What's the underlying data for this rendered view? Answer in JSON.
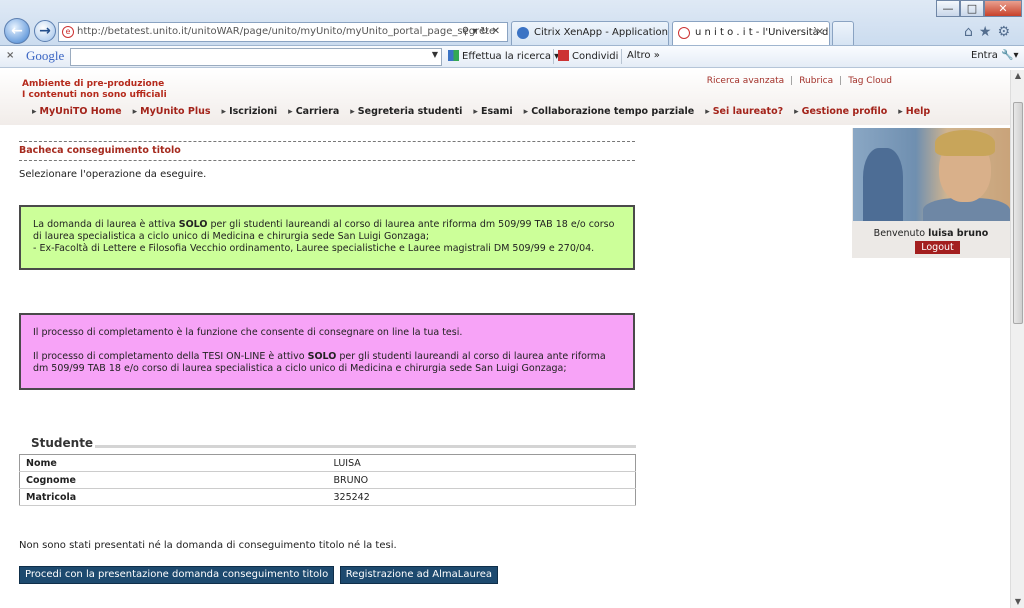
{
  "browser": {
    "address_url": "http://betatest.unito.it/unitoWAR/page/unito/myUnito/myUnito_portal_page_segrete",
    "address_domain": "unito.it",
    "tabs": [
      {
        "label": "Citrix XenApp - Applications"
      },
      {
        "label": "u n i t o . i t - l'Università di ..."
      }
    ]
  },
  "google_toolbar": {
    "logo": "Google",
    "search_placeholder": "",
    "search_btn": "Effettua la ricerca",
    "share_btn": "Condividi",
    "more_btn": "Altro",
    "signin": "Entra"
  },
  "header": {
    "env_line1": "Ambiente di pre-produzione",
    "env_line2": "I contenuti non sono ufficiali",
    "toplinks": [
      "Ricerca avanzata",
      "Rubrica",
      "Tag Cloud"
    ],
    "nav": [
      {
        "label": "MyUniTO Home",
        "red": true
      },
      {
        "label": "MyUnito Plus",
        "red": true
      },
      {
        "label": "Iscrizioni",
        "red": false
      },
      {
        "label": "Carriera",
        "red": false
      },
      {
        "label": "Segreteria studenti",
        "red": false
      },
      {
        "label": "Esami",
        "red": false
      },
      {
        "label": "Collaborazione tempo parziale",
        "red": false
      },
      {
        "label": "Sei laureato?",
        "red": true
      },
      {
        "label": "Gestione profilo",
        "red": true
      },
      {
        "label": "Help",
        "red": true
      }
    ]
  },
  "main": {
    "section_title": "Bacheca conseguimento titolo",
    "instruction": "Selezionare l'operazione da eseguire.",
    "green_box": {
      "p1_pre": "La domanda di laurea è attiva ",
      "p1_bold": "SOLO",
      "p1_post": " per gli studenti laureandi al corso di laurea ante riforma dm 509/99 TAB 18 e/o corso di laurea specialistica a ciclo unico di Medicina e chirurgia sede San Luigi Gonzaga;",
      "p2": "- Ex-Facoltà di Lettere e Filosofia Vecchio ordinamento, Lauree specialistiche e Lauree magistrali DM 509/99 e 270/04."
    },
    "pink_box": {
      "p1": "Il processo di completamento è la funzione che consente di consegnare on line la tua tesi.",
      "p2_pre": "Il processo di completamento della TESI ON-LINE è attivo ",
      "p2_bold": "SOLO",
      "p2_post": " per gli studenti laureandi al corso di laurea ante riforma dm 509/99 TAB 18 e/o corso di laurea specialistica a ciclo unico di Medicina e chirurgia sede San Luigi Gonzaga;"
    },
    "student": {
      "legend": "Studente",
      "rows": [
        {
          "label": "Nome",
          "value": "LUISA"
        },
        {
          "label": "Cognome",
          "value": "BRUNO"
        },
        {
          "label": "Matricola",
          "value": "325242"
        }
      ]
    },
    "note": "Non sono stati presentati né la domanda di conseguimento titolo né la tesi.",
    "buttons": {
      "proceed": "Procedi con la presentazione domanda conseguimento titolo",
      "almalaurea": "Registrazione ad AlmaLaurea"
    }
  },
  "sidebar": {
    "welcome_prefix": "Benvenuto",
    "user_name": "luisa bruno",
    "logout": "Logout"
  }
}
